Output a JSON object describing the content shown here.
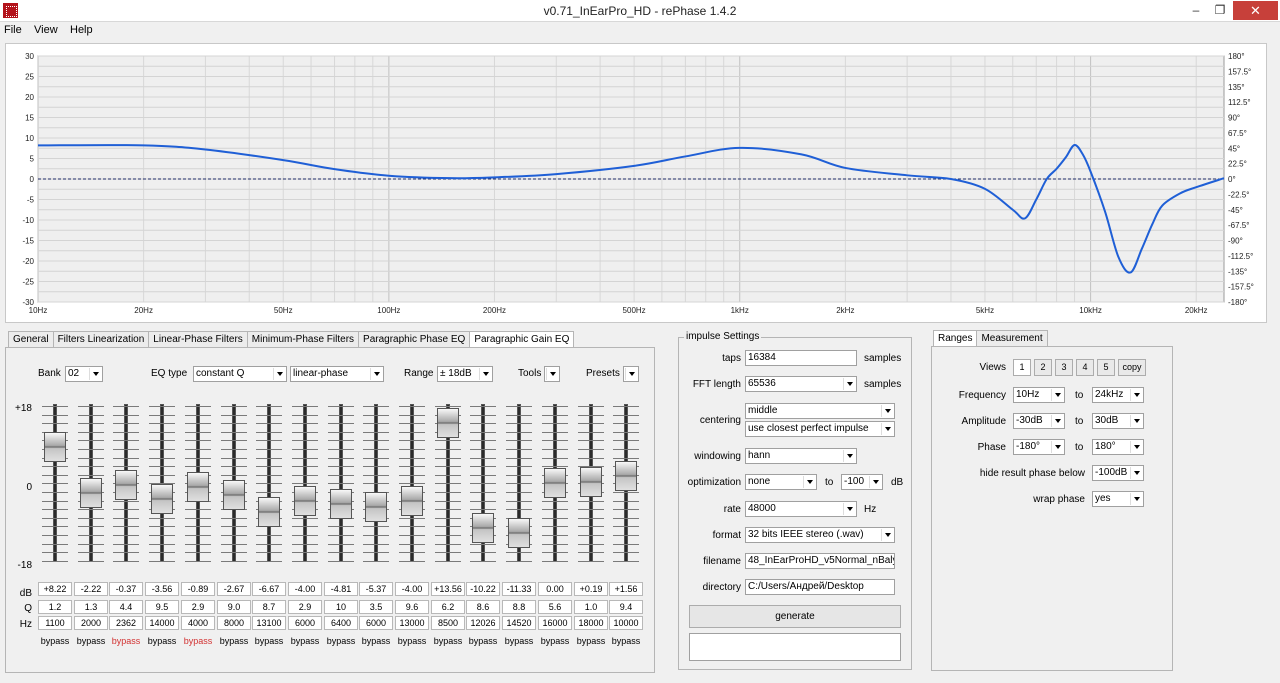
{
  "window": {
    "title": "v0.71_InEarPro_HD  -  rePhase 1.4.2",
    "minimize": "–",
    "maximize": "❐",
    "close": "✕"
  },
  "menu": [
    "File",
    "View",
    "Help"
  ],
  "graph": {
    "left_axis": [
      "30",
      "25",
      "20",
      "15",
      "10",
      "5",
      "0",
      "-5",
      "-10",
      "-15",
      "-20",
      "-25",
      "-30"
    ],
    "right_axis": [
      "180°",
      "157.5°",
      "135°",
      "112.5°",
      "90°",
      "67.5°",
      "45°",
      "22.5°",
      "0°",
      "-22.5°",
      "-45°",
      "-67.5°",
      "-90°",
      "-112.5°",
      "-135°",
      "-157.5°",
      "-180°"
    ],
    "freq_labels": [
      "10Hz",
      "20Hz",
      "50Hz",
      "100Hz",
      "200Hz",
      "500Hz",
      "1kHz",
      "2kHz",
      "5kHz",
      "10kHz",
      "20kHz"
    ],
    "curve_color": "#1f5fd6",
    "curve_hz": [
      10,
      20,
      30,
      50,
      70,
      100,
      150,
      200,
      300,
      500,
      700,
      1000,
      1500,
      2000,
      3000,
      4000,
      5000,
      6000,
      6500,
      7000,
      7500,
      8000,
      8500,
      9000,
      9500,
      10000,
      11000,
      12000,
      13000,
      14000,
      15000,
      16000,
      18000,
      20000,
      24000
    ],
    "curve_db": [
      8.2,
      8.2,
      7.2,
      4.6,
      2.4,
      0.8,
      0.2,
      0.4,
      1.2,
      3.2,
      5.5,
      7.6,
      6.0,
      2.7,
      0.9,
      0.0,
      -2.4,
      -7.5,
      -9.6,
      -5.0,
      0.0,
      2.5,
      5.3,
      8.3,
      6.0,
      1.8,
      -8.0,
      -19.0,
      -22.8,
      -17.0,
      -11.0,
      -6.5,
      -3.5,
      -2.0,
      0.2
    ]
  },
  "eq_tabs": [
    "General",
    "Filters Linearization",
    "Linear-Phase Filters",
    "Minimum-Phase Filters",
    "Paragraphic Phase EQ",
    "Paragraphic Gain EQ"
  ],
  "eq_active_tab": 5,
  "eq": {
    "bank_label": "Bank",
    "bank_value": "02",
    "eqtype_label": "EQ type",
    "eqtype_value": "constant Q",
    "phase_value": "linear-phase",
    "range_label": "Range",
    "range_value": "± 18dB",
    "tools_label": "Tools",
    "presets_label": "Presets",
    "scale_top": "+18",
    "scale_mid": "0",
    "scale_bottom": "-18",
    "row_db": "dB",
    "row_q": "Q",
    "row_hz": "Hz",
    "range_db": 18,
    "bands": [
      {
        "db": "+8.22",
        "q": "1.2",
        "hz": "1100",
        "bypass": "bypass",
        "red": false
      },
      {
        "db": "-2.22",
        "q": "1.3",
        "hz": "2000",
        "bypass": "bypass",
        "red": false
      },
      {
        "db": "-0.37",
        "q": "4.4",
        "hz": "2362",
        "bypass": "bypass",
        "red": true
      },
      {
        "db": "-3.56",
        "q": "9.5",
        "hz": "14000",
        "bypass": "bypass",
        "red": false
      },
      {
        "db": "-0.89",
        "q": "2.9",
        "hz": "4000",
        "bypass": "bypass",
        "red": true
      },
      {
        "db": "-2.67",
        "q": "9.0",
        "hz": "8000",
        "bypass": "bypass",
        "red": false
      },
      {
        "db": "-6.67",
        "q": "8.7",
        "hz": "13100",
        "bypass": "bypass",
        "red": false
      },
      {
        "db": "-4.00",
        "q": "2.9",
        "hz": "6000",
        "bypass": "bypass",
        "red": false
      },
      {
        "db": "-4.81",
        "q": "10",
        "hz": "6400",
        "bypass": "bypass",
        "red": false
      },
      {
        "db": "-5.37",
        "q": "3.5",
        "hz": "6000",
        "bypass": "bypass",
        "red": false
      },
      {
        "db": "-4.00",
        "q": "9.6",
        "hz": "13000",
        "bypass": "bypass",
        "red": false
      },
      {
        "db": "+13.56",
        "q": "6.2",
        "hz": "8500",
        "bypass": "bypass",
        "red": false
      },
      {
        "db": "-10.22",
        "q": "8.6",
        "hz": "12026",
        "bypass": "bypass",
        "red": false
      },
      {
        "db": "-11.33",
        "q": "8.8",
        "hz": "14520",
        "bypass": "bypass",
        "red": false
      },
      {
        "db": "0.00",
        "q": "5.6",
        "hz": "16000",
        "bypass": "bypass",
        "red": false
      },
      {
        "db": "+0.19",
        "q": "1.0",
        "hz": "18000",
        "bypass": "bypass",
        "red": false
      },
      {
        "db": "+1.56",
        "q": "9.4",
        "hz": "10000",
        "bypass": "bypass",
        "red": false
      }
    ]
  },
  "impulse": {
    "title": "impulse Settings",
    "taps_label": "taps",
    "taps_value": "16384",
    "taps_unit": "samples",
    "fft_label": "FFT length",
    "fft_value": "65536",
    "fft_unit": "samples",
    "centering_label": "centering",
    "centering_value": "middle",
    "centering_value2": "use closest perfect impulse",
    "windowing_label": "windowing",
    "windowing_value": "hann",
    "optimization_label": "optimization",
    "optimization_value": "none",
    "opt_to": "to",
    "opt_db": "-100",
    "opt_unit": "dB",
    "rate_label": "rate",
    "rate_value": "48000",
    "rate_unit": "Hz",
    "format_label": "format",
    "format_value": "32 bits IEEE stereo (.wav)",
    "filename_label": "filename",
    "filename_value": "48_InEarProHD_v5Normal_nBaly",
    "directory_label": "directory",
    "directory_value": "C:/Users/Андрей/Desktop",
    "generate_label": "generate"
  },
  "ranges_tabs": [
    "Ranges",
    "Measurement"
  ],
  "ranges": {
    "views_label": "Views",
    "views": [
      "1",
      "2",
      "3",
      "4",
      "5"
    ],
    "copy_label": "copy",
    "frequency_label": "Frequency",
    "freq_from": "10Hz",
    "to_label": "to",
    "freq_to": "24kHz",
    "amplitude_label": "Amplitude",
    "amp_from": "-30dB",
    "amp_to": "30dB",
    "phase_label": "Phase",
    "phase_from": "-180°",
    "phase_to": "180°",
    "hide_label": "hide result phase below",
    "hide_value": "-100dB",
    "wrap_label": "wrap phase",
    "wrap_value": "yes"
  }
}
